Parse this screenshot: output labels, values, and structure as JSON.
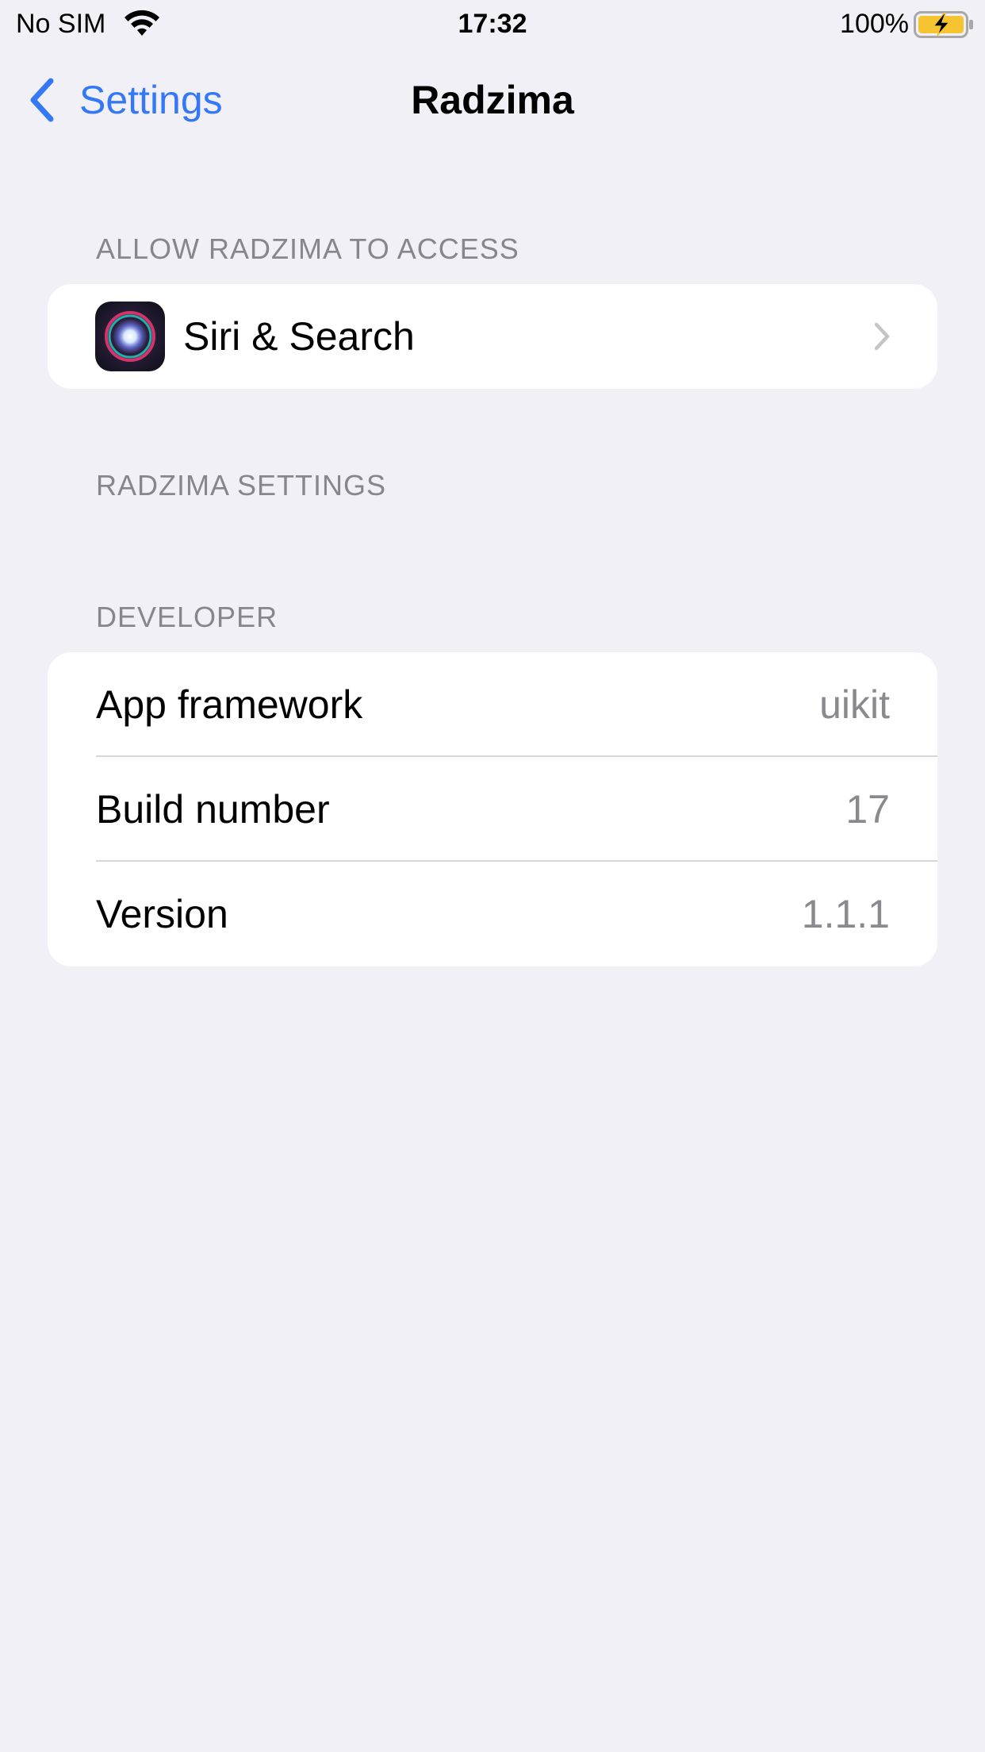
{
  "status_bar": {
    "carrier": "No SIM",
    "time": "17:32",
    "battery_percent": "100%",
    "wifi_icon": "wifi-icon",
    "battery_icon": "battery-charging-icon",
    "battery_color": "#f5c430"
  },
  "nav": {
    "back_label": "Settings",
    "back_icon": "chevron-left-icon",
    "title": "Radzima",
    "accent_color": "#3478f6"
  },
  "sections": {
    "access": {
      "header": "ALLOW RADZIMA TO ACCESS",
      "items": [
        {
          "label": "Siri & Search",
          "icon": "siri-icon",
          "accessory": "chevron-right-icon"
        }
      ]
    },
    "settings": {
      "header": "RADZIMA SETTINGS"
    },
    "developer": {
      "header": "DEVELOPER",
      "items": [
        {
          "label": "App framework",
          "value": "uikit"
        },
        {
          "label": "Build number",
          "value": "17"
        },
        {
          "label": "Version",
          "value": "1.1.1"
        }
      ]
    }
  }
}
